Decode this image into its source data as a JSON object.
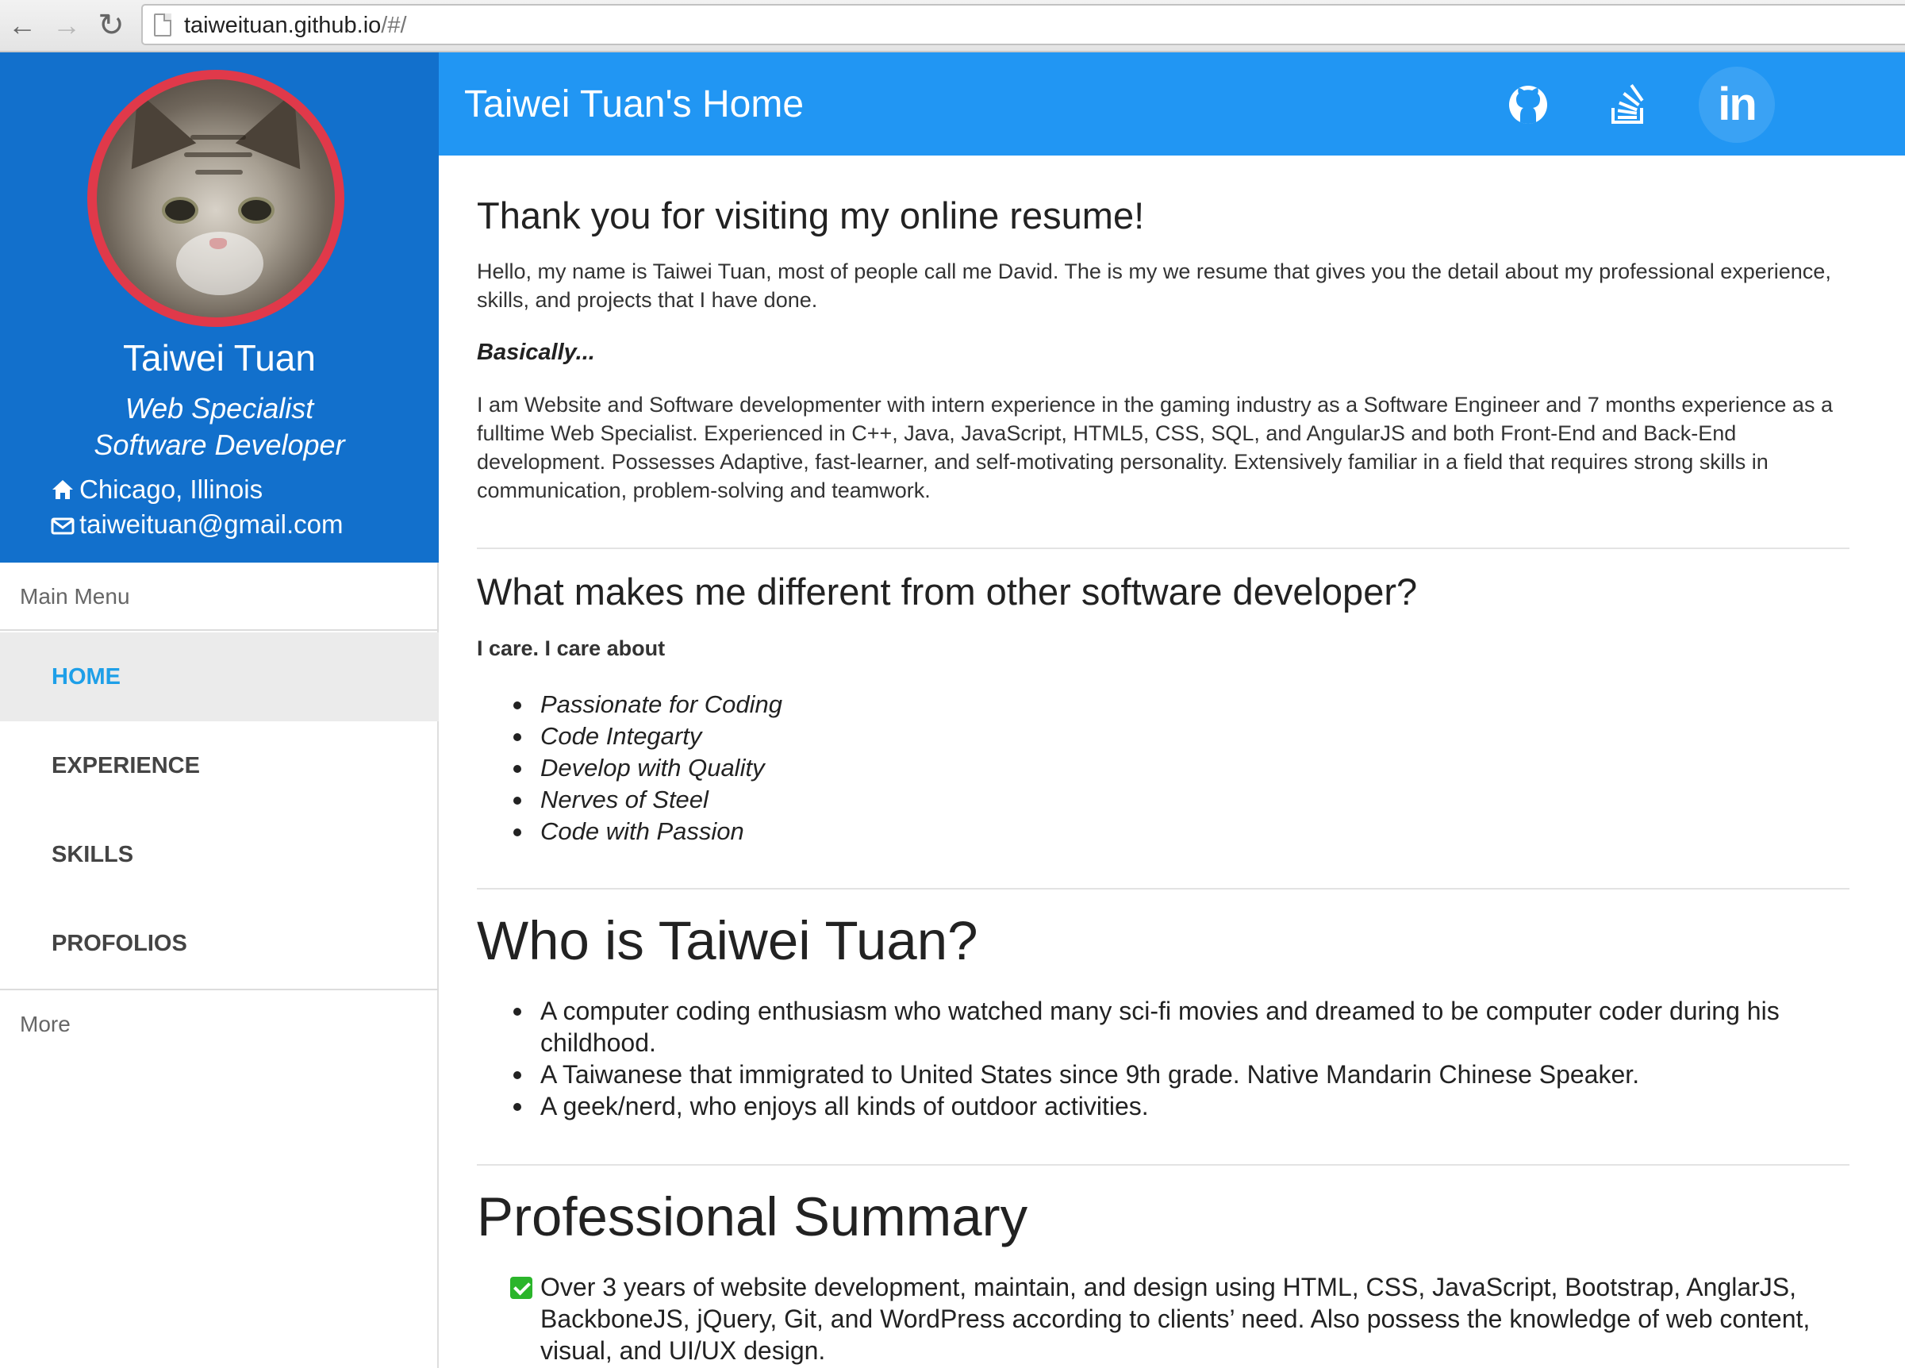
{
  "browser": {
    "url_host": "taiweituan.github.io",
    "url_path": "/#/"
  },
  "profile": {
    "name": "Taiwei Tuan",
    "roles": [
      "Web Specialist",
      "Software Developer"
    ],
    "location": "Chicago, Illinois",
    "email": "taiweituan@gmail.com"
  },
  "menu": {
    "main_label": "Main Menu",
    "items": [
      {
        "label": "HOME",
        "active": true
      },
      {
        "label": "EXPERIENCE",
        "active": false
      },
      {
        "label": "SKILLS",
        "active": false
      },
      {
        "label": "PROFOLIOS",
        "active": false
      }
    ],
    "more_label": "More"
  },
  "header": {
    "title": "Taiwei Tuan's Home",
    "social": [
      {
        "name": "github-icon"
      },
      {
        "name": "stackoverflow-icon"
      },
      {
        "name": "linkedin-icon",
        "label": "in"
      }
    ],
    "color": "#2196f3"
  },
  "sidebar_color": "#1270cc",
  "accent_active": "#1e9fe8",
  "intro": {
    "heading": "Thank you for visiting my online resume!",
    "paragraph": "Hello, my name is Taiwei Tuan, most of people call me David. The is my we resume that gives you the detail about my professional experience, skills, and projects that I have done.",
    "basically": "Basically...",
    "paragraph2": "I am Website and Software developmenter with intern experience in the gaming industry as a Software Engineer and 7 months experience as a fulltime Web Specialist. Experienced in C++, Java, JavaScript, HTML5, CSS, SQL, and AngularJS and both Front-End and Back-End development. Possesses Adaptive, fast-learner, and self-motivating personality. Extensively familiar in a field that requires strong skills in communication, problem-solving and teamwork."
  },
  "different": {
    "heading": "What makes me different from other software developer?",
    "lead": "I care. I care about",
    "items": [
      "Passionate for Coding",
      "Code Integarty",
      "Develop with Quality",
      "Nerves of Steel",
      "Code with Passion"
    ]
  },
  "who": {
    "heading": "Who is Taiwei Tuan?",
    "items": [
      "A computer coding enthusiasm who watched many sci-fi movies and dreamed to be computer coder during his childhood.",
      "A Taiwanese that immigrated to United States since 9th grade. Native Mandarin Chinese Speaker.",
      "A geek/nerd, who enjoys all kinds of outdoor activities."
    ]
  },
  "summary": {
    "heading": "Professional Summary",
    "items": [
      "Over 3 years of website development, maintain, and design using HTML, CSS, JavaScript, Bootstrap, AnglarJS, BackboneJS, jQuery, Git, and WordPress according to clients’ need. Also possess the knowledge of web content, visual, and UI/UX design."
    ]
  }
}
